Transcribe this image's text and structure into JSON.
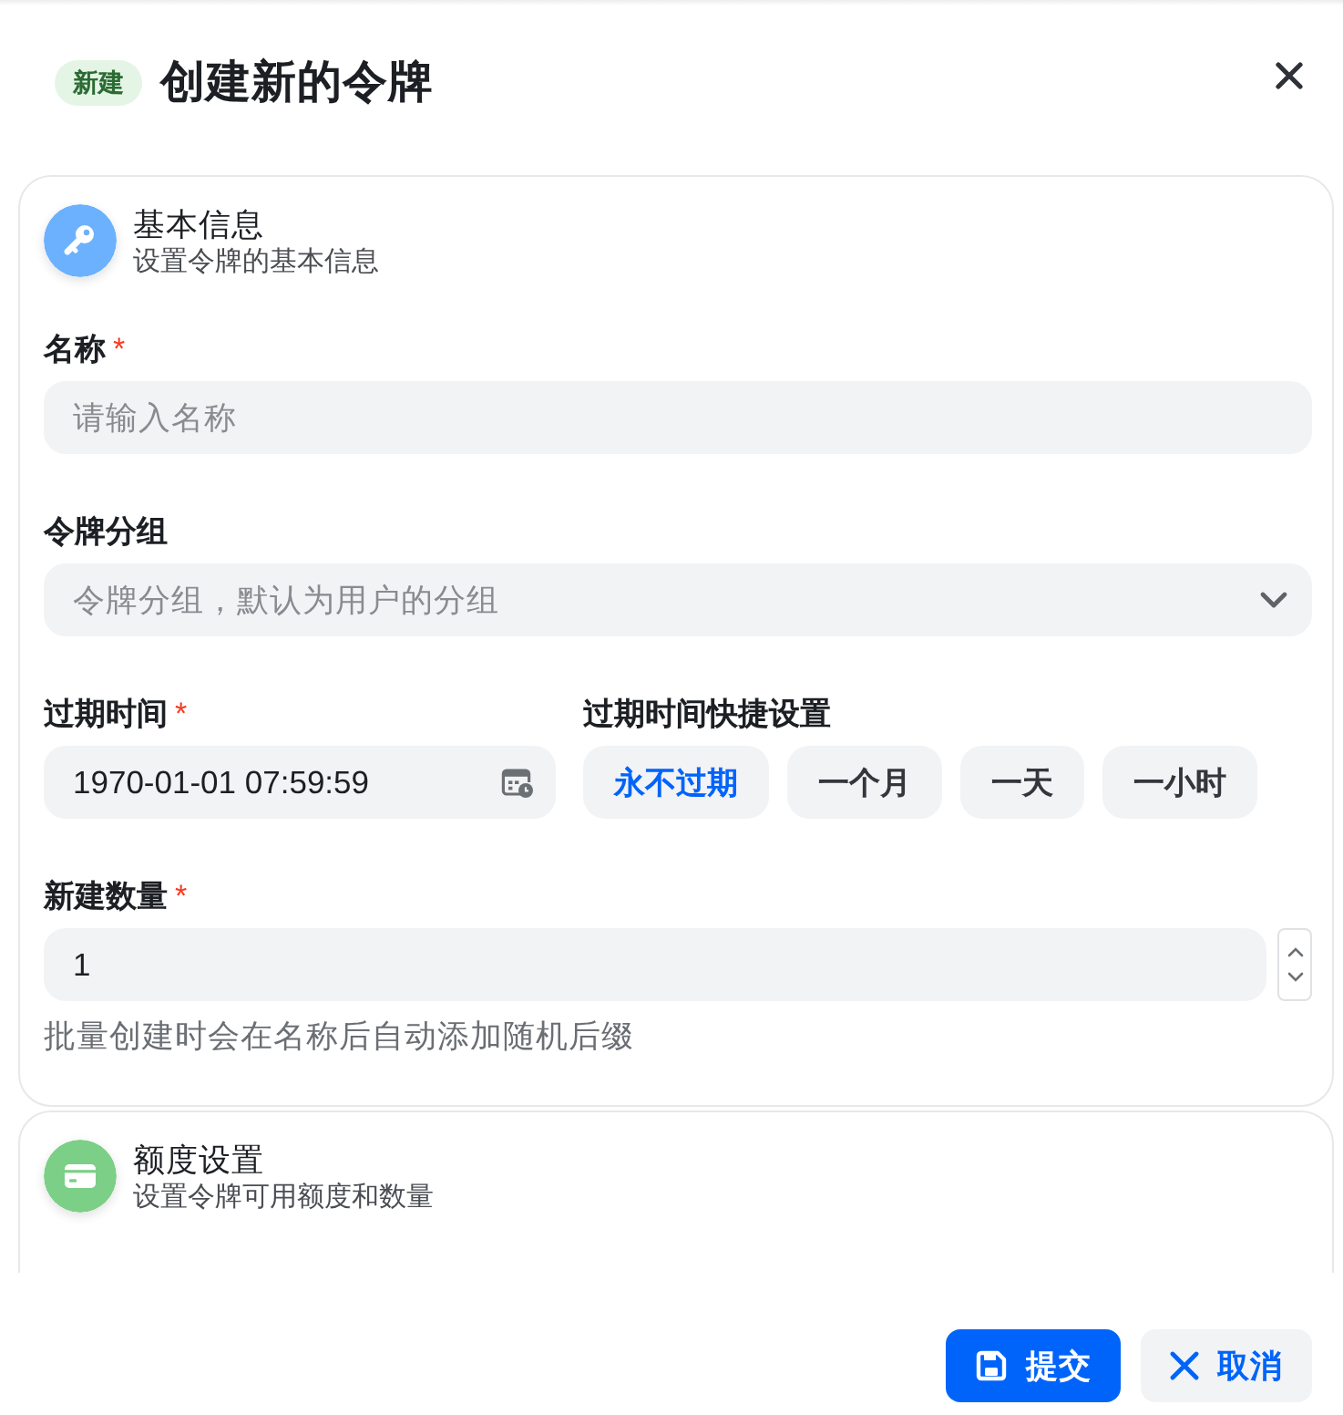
{
  "dialog": {
    "badge": "新建",
    "title": "创建新的令牌"
  },
  "sections": [
    {
      "kind": "basic",
      "color": "#6bb1fe",
      "title": "基本信息",
      "subtitle": "设置令牌的基本信息",
      "fields": [
        {
          "kind": "text",
          "label": "名称",
          "required_mark": "*",
          "placeholder": "请输入名称"
        },
        {
          "kind": "select",
          "label": "令牌分组",
          "placeholder": "令牌分组，默认为用户的分组"
        },
        {
          "kind": "datetime",
          "label": "过期时间",
          "required_mark": "*",
          "value": "1970-01-01 07:59:59",
          "quick": {
            "label": "过期时间快捷设置",
            "options": [
              {
                "label": "永不过期",
                "selected": true
              },
              {
                "label": "一个月",
                "selected": false
              },
              {
                "label": "一天",
                "selected": false
              },
              {
                "label": "一小时",
                "selected": false
              }
            ]
          }
        },
        {
          "kind": "number",
          "label": "新建数量",
          "required_mark": "*",
          "value": "1",
          "help": "批量创建时会在名称后自动添加随机后缀"
        }
      ]
    },
    {
      "kind": "quota",
      "color": "#7ccf86",
      "title": "额度设置",
      "subtitle": "设置令牌可用额度和数量"
    }
  ],
  "footer": {
    "buttons": [
      {
        "kind": "submit",
        "label": "提交"
      },
      {
        "kind": "cancel",
        "label": "取消"
      }
    ]
  }
}
